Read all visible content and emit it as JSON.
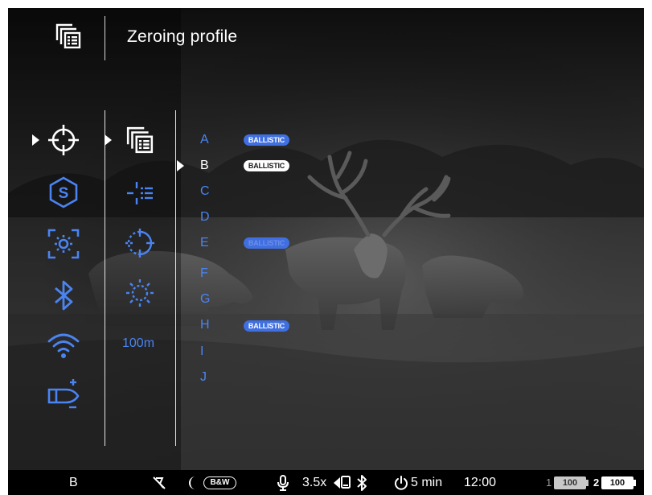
{
  "header": {
    "title": "Zeroing profile",
    "icon": "zeroing-profile-icon"
  },
  "main_menu": {
    "items": [
      {
        "name": "crosshair-icon",
        "selected": true
      },
      {
        "name": "s-hexagon-icon"
      },
      {
        "name": "brightness-frame-icon"
      },
      {
        "name": "bluetooth-icon"
      },
      {
        "name": "wifi-icon"
      },
      {
        "name": "cartridge-plus-minus-icon"
      }
    ]
  },
  "sub_menu": {
    "items": [
      {
        "name": "zeroing-profile-icon",
        "selected": true
      },
      {
        "name": "reticle-list-icon"
      },
      {
        "name": "zeroing-target-icon"
      },
      {
        "name": "sun-dotted-icon"
      }
    ],
    "distance": "100m"
  },
  "profiles": [
    {
      "letter": "A",
      "badge": "BALLISTIC"
    },
    {
      "letter": "B",
      "badge": "BALLISTIC",
      "active": true
    },
    {
      "letter": "C",
      "badge": ""
    },
    {
      "letter": "D",
      "badge": ""
    },
    {
      "letter": "E",
      "badge": "BALLISTIC",
      "faded": true
    },
    {
      "letter": "F",
      "badge": ""
    },
    {
      "letter": "G",
      "badge": ""
    },
    {
      "letter": "H",
      "badge": "BALLISTIC"
    },
    {
      "letter": "I",
      "badge": ""
    },
    {
      "letter": "J",
      "badge": ""
    }
  ],
  "status_bar": {
    "profile": "B",
    "mode_badge": "B&W",
    "zoom": "3.5x",
    "auto_off": "5 min",
    "time": "12:00",
    "battery1_index": "1",
    "battery1_value": "100",
    "battery2_index": "2",
    "battery2_value": "100"
  },
  "colors": {
    "accent": "#4a84f2",
    "badge": "#3f6fe0",
    "text": "#ffffff",
    "statusbar": "#000000"
  }
}
